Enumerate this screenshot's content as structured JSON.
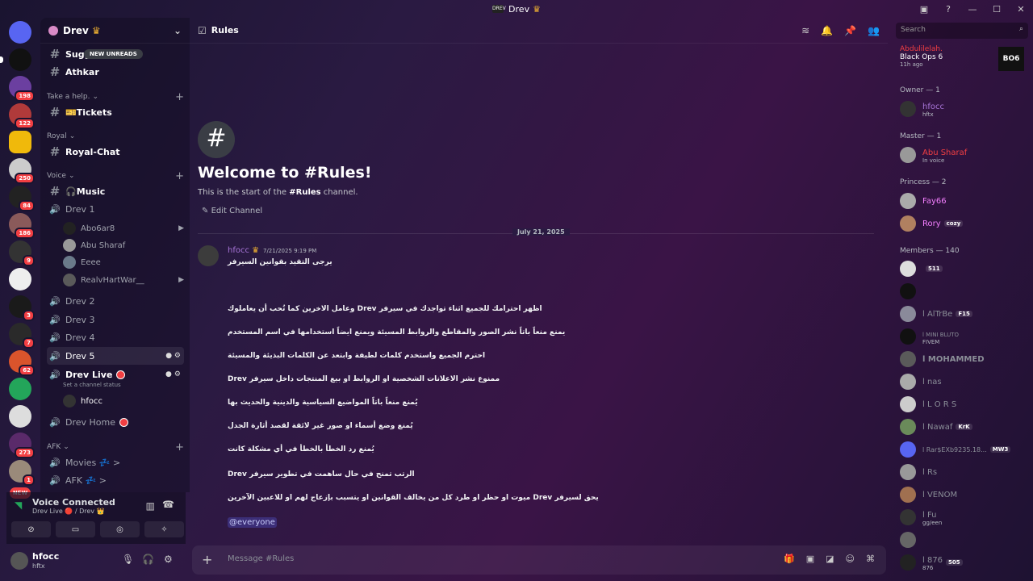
{
  "app": {
    "title": "Drev"
  },
  "server": {
    "name": "Drev"
  },
  "new_unreads": "NEW UNREADS",
  "channels": {
    "top": [
      "Sugg",
      "Athkar"
    ],
    "cat_help": "Take a help.",
    "tickets": "🎫Tickets",
    "cat_royal": "Royal",
    "royal_chat": "Royal-Chat",
    "cat_voice": "Voice",
    "music": "🎧Music",
    "drev1": "Drev 1",
    "drev1_users": [
      "Abo6ar8",
      "Abu Sharaf",
      "Eeee",
      "RealvHartWar__"
    ],
    "drev2": "Drev 2",
    "drev3": "Drev 3",
    "drev4": "Drev 4",
    "drev5": "Drev 5",
    "drev_live": "Drev Live",
    "drev_live_status": "Set a channel status",
    "drev_live_user": "hfocc",
    "drev_home": "Drev Home",
    "cat_afk": "AFK",
    "movies": "Movies 💤 >",
    "afk": "AFK 💤 >"
  },
  "server_badges": [
    "198",
    "122",
    "250",
    "84",
    "186",
    "9",
    "3",
    "7",
    "62",
    "273",
    "1",
    "19"
  ],
  "voice": {
    "title": "Voice Connected",
    "sub": "Drev Live 🔴 / Drev 👑"
  },
  "user": {
    "name": "hfocc",
    "status": "hftx"
  },
  "channel": {
    "name": "Rules",
    "welcome": "Welcome to #Rules!",
    "welcome_sub_a": "This is the start of the ",
    "welcome_sub_b": "#Rules",
    "welcome_sub_c": " channel.",
    "edit": "Edit Channel"
  },
  "search_placeholder": "Search",
  "date_divider": "July 21, 2025",
  "message": {
    "author": "hfocc",
    "timestamp": "7/21/2025 9:19 PM",
    "lines": [
      "يرجى التقيد بقوانين السيرفر",
      "اظهر احترامك للجميع اثناء تواجدك في سيرفر Drev وعامل الاخرين كما تُحب أن يعاملوك",
      "يمنع منعاً باتاً نشر الصور والمقاطع والروابط المسيئة ويمنع ايضاً استخدامها في اسم المستخدم",
      "احترم الجميع واستخدم كلمات لطيفة وابتعد عن الكلمات البذيئة والمسيئة",
      "ممنوع نشر الاعلانات الشخصية او الروابط او بيع المنتجات داخل سيرفر Drev",
      "يُمنع منعاً باتاً المواضيع السياسية والدينية والحديث بها",
      "يُمنع وضع أسماء او صور غير لائقة لقصد أثارة الجدل",
      "يُمنع رد الخطأ بالخطأ في أي مشكلة كانت",
      "الرتب تمنح في حال ساهمت في تطوير سيرفر Drev",
      "يحق لسيرفر Drev ميوت او حظر او طرد كل من يخالف القوانين او يتسبب بإزعاج لهم او للاعبين الآخرين"
    ],
    "mention": "@everyone"
  },
  "composer_placeholder": "Message #Rules",
  "members": {
    "activity_user": "Abdulilelah.",
    "activity_game": "Black Ops 6",
    "activity_time": "11h ago",
    "game_logo": "BO6",
    "owner_cat": "Owner — 1",
    "owner": "hfocc",
    "owner_sub": "hftx",
    "master_cat": "Master — 1",
    "master": "Abu Sharaf",
    "master_sub": "In voice",
    "princess_cat": "Princess — 2",
    "princess1": "Fay66",
    "princess2": "Rory",
    "rory_tag": "cozy",
    "members_cat": "Members — 140",
    "list": [
      {
        "name": "",
        "tag": "511"
      },
      {
        "name": "",
        "tag": ""
      },
      {
        "name": "l AlTrBe",
        "tag": "F15"
      },
      {
        "name": "l MINI BLUTO",
        "tag": "",
        "sub": "FIVEM"
      },
      {
        "name": "l MOHAMMED",
        "tag": ""
      },
      {
        "name": "l nas",
        "tag": ""
      },
      {
        "name": "l L O R S",
        "tag": ""
      },
      {
        "name": "l Nawaf",
        "tag": "KrK"
      },
      {
        "name": "l Rar$EXb9235.18...",
        "tag": "MW3"
      },
      {
        "name": "l Rs",
        "tag": ""
      },
      {
        "name": "l VENOM",
        "tag": ""
      },
      {
        "name": "l Fu",
        "tag": "",
        "sub": "gg/een"
      },
      {
        "name": "",
        "tag": ""
      },
      {
        "name": "l 876",
        "tag": "505",
        "sub": "876"
      }
    ]
  }
}
